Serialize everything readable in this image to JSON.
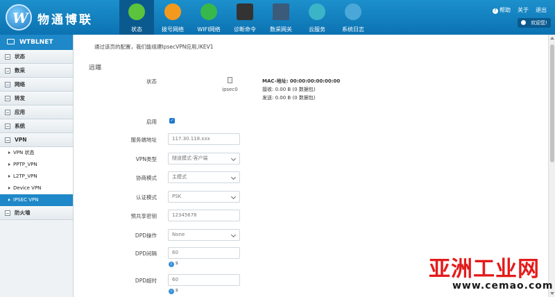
{
  "header": {
    "brand": "物通博联",
    "nav": [
      {
        "label": "状态",
        "icon": "home-icon",
        "color": "#5bc43c",
        "active": true
      },
      {
        "label": "拨号网络",
        "icon": "antenna-icon",
        "color": "#f39a1e"
      },
      {
        "label": "WIFI网络",
        "icon": "wifi-icon",
        "color": "#38b84a"
      },
      {
        "label": "诊断命令",
        "icon": "terminal-icon",
        "color": "#333333"
      },
      {
        "label": "数采网关",
        "icon": "server-icon",
        "color": "#3b5b7a"
      },
      {
        "label": "云服务",
        "icon": "cloud-icon",
        "color": "#3bb4c8"
      },
      {
        "label": "系统日志",
        "icon": "stethoscope-icon",
        "color": "#4aa8d8"
      }
    ],
    "help": "帮助",
    "about": "关于",
    "logout": "退出",
    "user": "欢迎您!"
  },
  "sidebar": {
    "title": "WTBLNET",
    "sections": [
      "状态",
      "数采",
      "网络",
      "转发",
      "应用",
      "系统",
      "VPN"
    ],
    "vpn_items": [
      "VPN 状态",
      "PPTP_VPN",
      "L2TP_VPN",
      "Device VPN",
      "IPSEC VPN"
    ],
    "after": "防火墙"
  },
  "main": {
    "intro": "通过该页的配置，我们能组建IpsecVPN应用,IKEV1",
    "section_title": "远端",
    "status_label": "状态",
    "iface": "ipsec0",
    "mac": "MAC-地址: 00:00:00:00:00:00",
    "rx": "接收: 0.00 B (0 数据包)",
    "tx": "发送: 0.00 B (0 数据包)",
    "enable_label": "启用",
    "server_label": "服务端地址",
    "server_value": "117.30.118.xxx",
    "vpn_type_label": "VPN类型",
    "vpn_type_value": "隧道模式-客户端",
    "negotiate_label": "协商模式",
    "negotiate_value": "主模式",
    "auth_label": "认证模式",
    "auth_value": "PSK",
    "psk_label": "预共享密钥",
    "psk_value": "12345678",
    "dpd_action_label": "DPD操作",
    "dpd_action_value": "None",
    "dpd_interval_label": "DPD间隔",
    "dpd_interval_value": "60",
    "dpd_timeout_label": "DPD超时",
    "dpd_timeout_value": "60",
    "unit": "s"
  },
  "watermark": {
    "cn": "亚洲工业网",
    "url": "www.cemao.com"
  }
}
